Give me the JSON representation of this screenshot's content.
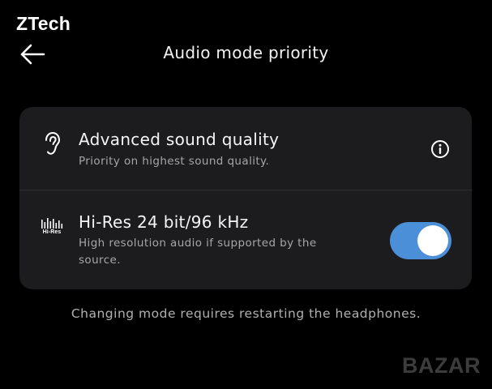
{
  "brand": "ZTech",
  "header": {
    "back_icon": "arrow-left-icon",
    "title": "Audio mode priority"
  },
  "options": [
    {
      "icon": "ear-icon",
      "title": "Advanced sound quality",
      "description": "Priority on highest sound quality.",
      "action_icon": "info-icon"
    },
    {
      "icon": "hi-res-icon",
      "icon_label": "Hi-Res",
      "title": "Hi-Res 24 bit/96 kHz",
      "description": "High resolution audio if supported by the source.",
      "toggle_on": true
    }
  ],
  "footnote": "Changing mode requires restarting the headphones.",
  "watermark": "BAZAR",
  "colors": {
    "background": "#000000",
    "card": "#1c1c1e",
    "toggle_on": "#4a8fd8",
    "secondary_text": "#a6a6a6"
  }
}
